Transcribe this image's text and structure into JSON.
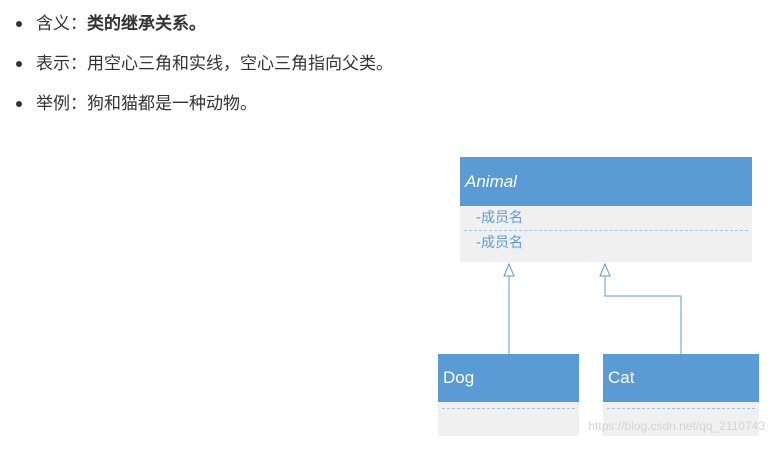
{
  "bullets": [
    {
      "label": "含义：",
      "text": "类的继承关系。",
      "bold": true
    },
    {
      "label": "表示：",
      "text": "用空心三角和实线，空心三角指向父类。",
      "bold": false
    },
    {
      "label": "举例：",
      "text": "狗和猫都是一种动物。",
      "bold": false
    }
  ],
  "diagram": {
    "parent": {
      "name": "Animal",
      "members": [
        "-成员名",
        "-成员名"
      ]
    },
    "children": [
      {
        "name": "Dog"
      },
      {
        "name": "Cat"
      }
    ]
  },
  "watermark": "https://blog.csdn.net/qq_2110743",
  "colors": {
    "class_header": "#5b9bd5",
    "class_body": "#f0f0f0",
    "text": "#333333"
  }
}
